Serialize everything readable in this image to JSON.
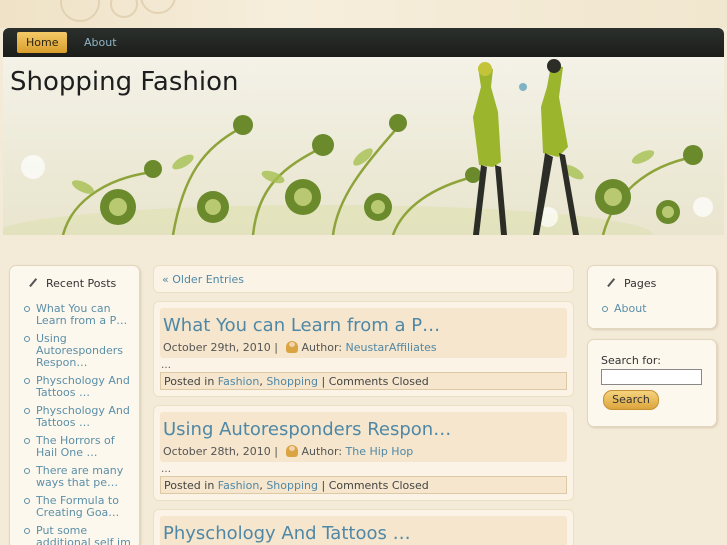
{
  "nav": {
    "items": [
      {
        "label": "Home",
        "active": true
      },
      {
        "label": "About",
        "active": false
      }
    ]
  },
  "header": {
    "site_title": "Shopping Fashion"
  },
  "recent_posts": {
    "title": "Recent Posts",
    "items": [
      "What You can Learn from a P…",
      "Using Autoresponders Respon…",
      "Physchology And Tattoos …",
      "Physchology And Tattoos …",
      "The Horrors of Hail One …",
      "There are many ways that pe…",
      "The Formula to Creating Goa…",
      "Put some additional self im …"
    ]
  },
  "older_entries": "« Older Entries",
  "posts": [
    {
      "title": "What You can Learn from a P…",
      "date": "October 29th, 2010",
      "author_label": "Author:",
      "author": "NeustarAffiliates",
      "excerpt": "…",
      "posted_in": "Posted in",
      "cat1": "Fashion",
      "cat2": "Shopping",
      "comments": "Comments Closed"
    },
    {
      "title": "Using Autoresponders Respon…",
      "date": "October 28th, 2010",
      "author_label": "Author:",
      "author": "The Hip Hop",
      "excerpt": "…",
      "posted_in": "Posted in",
      "cat1": "Fashion",
      "cat2": "Shopping",
      "comments": "Comments Closed"
    },
    {
      "title": "Physchology And Tattoos …"
    }
  ],
  "pages": {
    "title": "Pages",
    "items": [
      "About"
    ]
  },
  "search": {
    "label": "Search for:",
    "button": "Search",
    "value": ""
  },
  "colors": {
    "accent": "#4f88a6",
    "nav_bg": "#1f221f",
    "button": "#e3b04e"
  }
}
